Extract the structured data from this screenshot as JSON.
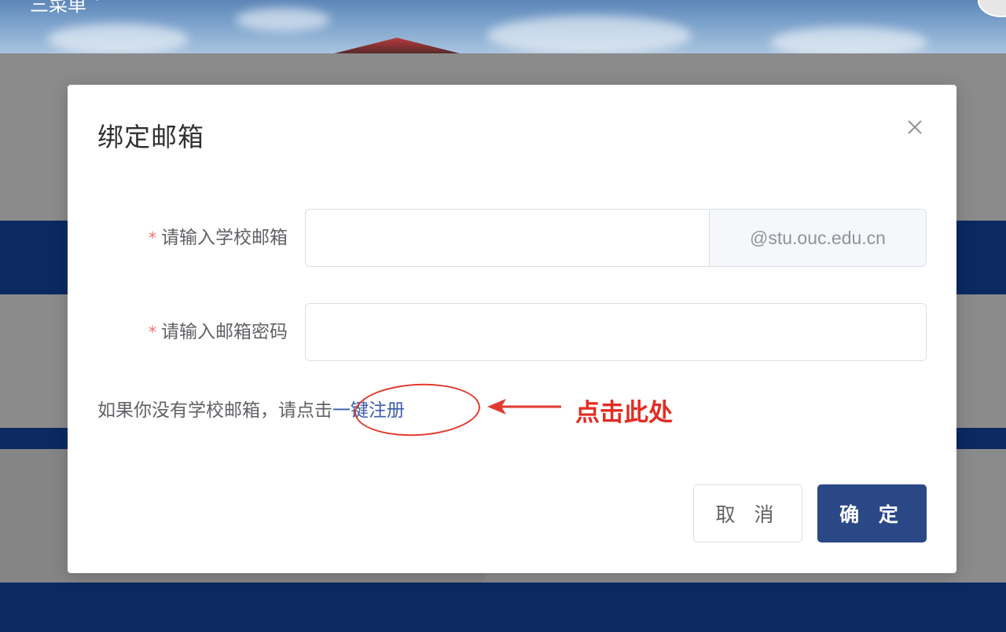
{
  "background": {
    "menu_label": "三菜单",
    "menu_chevron": "˅"
  },
  "dialog": {
    "title": "绑定邮箱",
    "close_icon": "close-icon",
    "fields": [
      {
        "required_mark": "*",
        "label": "请输入学校邮箱",
        "value": "",
        "placeholder": "",
        "append": "@stu.ouc.edu.cn"
      },
      {
        "required_mark": "*",
        "label": "请输入邮箱密码",
        "value": "",
        "placeholder": ""
      }
    ],
    "hint_text": "如果你没有学校邮箱，请点击",
    "register_link": "一键注册",
    "annotation": {
      "text": "点击此处",
      "color": "#e32b21"
    },
    "buttons": {
      "cancel": "取 消",
      "confirm": "确 定"
    }
  },
  "colors": {
    "primary": "#2a4886",
    "required": "#f56c6c",
    "link": "#3a5fa8"
  }
}
